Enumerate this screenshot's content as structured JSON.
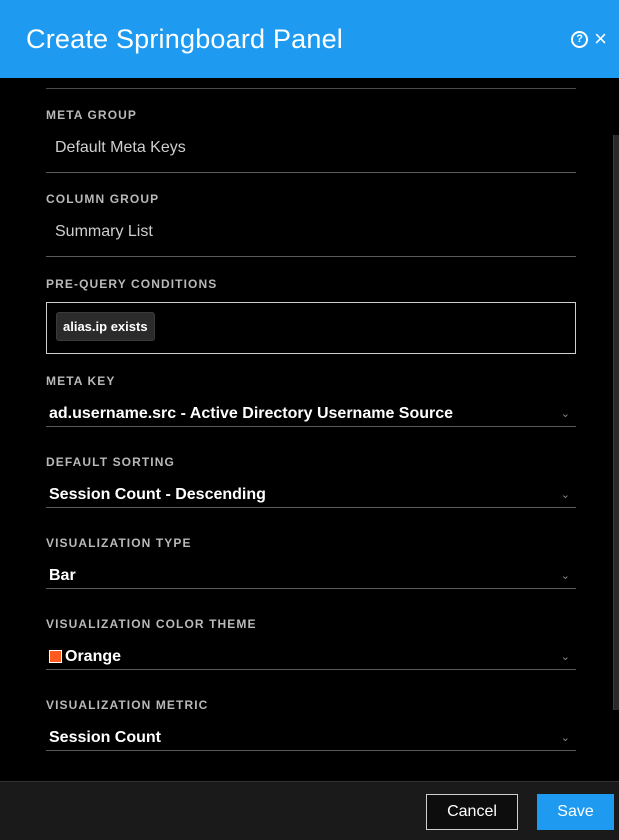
{
  "dialog": {
    "title": "Create Springboard Panel",
    "help_icon": "?",
    "close_icon": "×"
  },
  "fields": {
    "meta_group": {
      "label": "META GROUP",
      "value": "Default Meta Keys"
    },
    "column_group": {
      "label": "COLUMN GROUP",
      "value": "Summary List"
    },
    "pre_query_conditions": {
      "label": "PRE-QUERY CONDITIONS",
      "pill": "alias.ip exists"
    },
    "meta_key": {
      "label": "META KEY",
      "value": "ad.username.src - Active Directory Username Source"
    },
    "default_sorting": {
      "label": "DEFAULT SORTING",
      "value": "Session Count - Descending"
    },
    "visualization_type": {
      "label": "VISUALIZATION TYPE",
      "value": "Bar"
    },
    "visualization_color_theme": {
      "label": "VISUALIZATION COLOR THEME",
      "value": "Orange",
      "swatch_color": "#ff5a1f"
    },
    "visualization_metric": {
      "label": "VISUALIZATION METRIC",
      "value": "Session Count"
    }
  },
  "footer": {
    "cancel_label": "Cancel",
    "save_label": "Save"
  },
  "colors": {
    "header": "#1e9bf0",
    "background": "#000000",
    "accent": "#1e9bf0"
  },
  "icons": {
    "help": "help-icon",
    "close": "close-icon",
    "chevron": "chevron-down-icon"
  }
}
